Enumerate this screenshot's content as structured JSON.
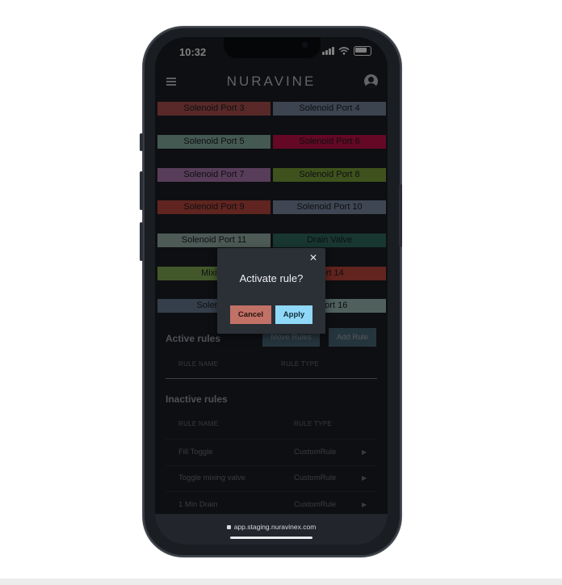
{
  "status": {
    "time": "10:32"
  },
  "app": {
    "brand": "NURAVINE"
  },
  "ports": [
    {
      "label": "Solenoid Port 3",
      "color": "#b05350"
    },
    {
      "label": "Solenoid Port 4",
      "color": "#78889e"
    },
    {
      "label": "Solenoid Port 5",
      "color": "#89b2a4"
    },
    {
      "label": "Solenoid Port 6",
      "color": "#c8104a"
    },
    {
      "label": "Solenoid Port 7",
      "color": "#b07bb4"
    },
    {
      "label": "Solenoid Port 8",
      "color": "#7ea53a"
    },
    {
      "label": "Solenoid Port 9",
      "color": "#c04a40"
    },
    {
      "label": "Solenoid Port 10",
      "color": "#7c8ea6"
    },
    {
      "label": "Solenoid Port 11",
      "color": "#9bb5ad"
    },
    {
      "label": "Drain Valve",
      "color": "#306e60"
    },
    {
      "label": "Mixing",
      "color": "#84b055"
    },
    {
      "label": "Port 14",
      "color": "#c2483c"
    },
    {
      "label": "Solenoid",
      "color": "#6a7c96"
    },
    {
      "label": "d Port 16",
      "color": "#9ec0bb"
    }
  ],
  "active_rules": {
    "title": "Active rules",
    "move_button": "Move Rules",
    "add_button": "Add Rule",
    "columns": [
      "RULE NAME",
      "RULE TYPE"
    ]
  },
  "inactive_rules": {
    "title": "Inactive rules",
    "columns": [
      "RULE NAME",
      "RULE TYPE"
    ],
    "rows": [
      {
        "name": "Fill Toggle",
        "type": "CustomRule"
      },
      {
        "name": "Toggle mixing valve",
        "type": "CustomRule"
      },
      {
        "name": "1 Min Drain",
        "type": "CustomRule"
      }
    ]
  },
  "modal": {
    "title": "Activate rule?",
    "close_icon": "close-icon",
    "cancel_label": "Cancel",
    "apply_label": "Apply"
  },
  "browser": {
    "url": "app.staging.nuravinex.com"
  }
}
